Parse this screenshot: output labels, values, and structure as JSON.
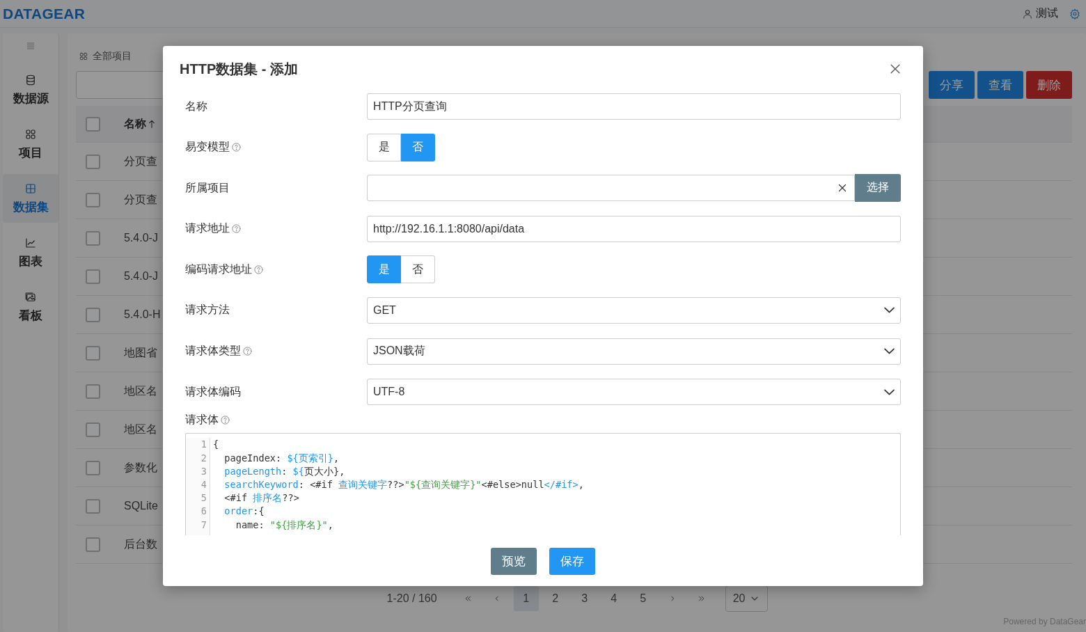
{
  "header": {
    "logo": "DATAGEAR",
    "user": "测试"
  },
  "sidebar": {
    "items": [
      {
        "kind": "database",
        "label": "数据源",
        "selected": false
      },
      {
        "kind": "grid",
        "label": "项目",
        "selected": false
      },
      {
        "kind": "table",
        "label": "数据集",
        "selected": true
      },
      {
        "kind": "chart",
        "label": "图表",
        "selected": false
      },
      {
        "kind": "picture",
        "label": "看板",
        "selected": false
      }
    ]
  },
  "main": {
    "breadcrumb": "全部项目",
    "buttons": [
      {
        "label": "分享",
        "kind": "primary"
      },
      {
        "label": "查看",
        "kind": "primary"
      },
      {
        "label": "删除",
        "kind": "danger"
      }
    ],
    "table": {
      "columns": [
        "名称"
      ],
      "header_checked": false,
      "rows": [
        {
          "name": "分页查",
          "checked": false
        },
        {
          "name": "分页查",
          "checked": false
        },
        {
          "name": "5.4.0-J",
          "checked": false
        },
        {
          "name": "5.4.0-J",
          "checked": false
        },
        {
          "name": "5.4.0-H",
          "checked": false
        },
        {
          "name": "地图省",
          "checked": false
        },
        {
          "name": "地区名",
          "checked": false
        },
        {
          "name": "地区名",
          "checked": false
        },
        {
          "name": "参数化",
          "checked": false
        },
        {
          "name": "SQLite",
          "checked": false
        },
        {
          "name": "后台数",
          "checked": false
        }
      ]
    }
  },
  "pagination": {
    "info": "1-20 / 160",
    "pages": [
      {
        "label": "1",
        "selected": true
      },
      {
        "label": "2",
        "selected": false
      },
      {
        "label": "3",
        "selected": false
      },
      {
        "label": "4",
        "selected": false
      },
      {
        "label": "5",
        "selected": false
      }
    ],
    "page_size": "20"
  },
  "footer": "Powered by DataGear",
  "dialog": {
    "title": "HTTP数据集 - 添加",
    "fields": [
      {
        "kind": "text",
        "label": "名称",
        "help": false,
        "value": "HTTP分页查询"
      },
      {
        "kind": "toggle",
        "label": "易变模型",
        "help": true,
        "options": [
          {
            "label": "是",
            "selected": false
          },
          {
            "label": "否",
            "selected": true
          }
        ]
      },
      {
        "kind": "picker",
        "label": "所属项目",
        "help": false,
        "button": "选择"
      },
      {
        "kind": "text",
        "label": "请求地址",
        "help": true,
        "value": "http://192.16.1.1:8080/api/data"
      },
      {
        "kind": "toggle",
        "label": "编码请求地址",
        "help": true,
        "options": [
          {
            "label": "是",
            "selected": true
          },
          {
            "label": "否",
            "selected": false
          }
        ]
      },
      {
        "kind": "select",
        "label": "请求方法",
        "help": false,
        "value": "GET"
      },
      {
        "kind": "select",
        "label": "请求体类型",
        "help": true,
        "value": "JSON载荷"
      },
      {
        "kind": "select",
        "label": "请求体编码",
        "help": false,
        "value": "UTF-8"
      }
    ],
    "body_label": "请求体",
    "body_help": true,
    "code": [
      {
        "no": "1",
        "tokens": [
          {
            "text": "{",
            "kind": "plain"
          }
        ]
      },
      {
        "no": "2",
        "tokens": [
          {
            "text": "  pageIndex: ",
            "kind": "plain"
          },
          {
            "text": "${页索引}",
            "kind": "key"
          },
          {
            "text": ",",
            "kind": "plain"
          }
        ]
      },
      {
        "no": "3",
        "tokens": [
          {
            "text": "  pageLength",
            "kind": "key"
          },
          {
            "text": ": ",
            "kind": "plain"
          },
          {
            "text": "${",
            "kind": "key"
          },
          {
            "text": "页大小},",
            "kind": "plain"
          }
        ]
      },
      {
        "no": "4",
        "tokens": [
          {
            "text": "  searchKeyword",
            "kind": "key"
          },
          {
            "text": ": <#if ",
            "kind": "plain"
          },
          {
            "text": "查询关键字",
            "kind": "key"
          },
          {
            "text": "??>",
            "kind": "plain"
          },
          {
            "text": "\"${查询关键字}\"",
            "kind": "str"
          },
          {
            "text": "<#else>null",
            "kind": "plain"
          },
          {
            "text": "</#if>",
            "kind": "key"
          },
          {
            "text": ",",
            "kind": "plain"
          }
        ]
      },
      {
        "no": "5",
        "tokens": [
          {
            "text": "  <#if ",
            "kind": "plain"
          },
          {
            "text": "排序名",
            "kind": "key"
          },
          {
            "text": "??>",
            "kind": "plain"
          }
        ]
      },
      {
        "no": "6",
        "tokens": [
          {
            "text": "  order",
            "kind": "key"
          },
          {
            "text": ":{",
            "kind": "plain"
          }
        ]
      },
      {
        "no": "7",
        "tokens": [
          {
            "text": "    name: ",
            "kind": "plain"
          },
          {
            "text": "\"${排序名}\"",
            "kind": "str"
          },
          {
            "text": ",",
            "kind": "plain"
          }
        ]
      }
    ],
    "buttons": [
      {
        "label": "预览",
        "kind": "secondary"
      },
      {
        "label": "保存",
        "kind": "primary"
      }
    ]
  }
}
